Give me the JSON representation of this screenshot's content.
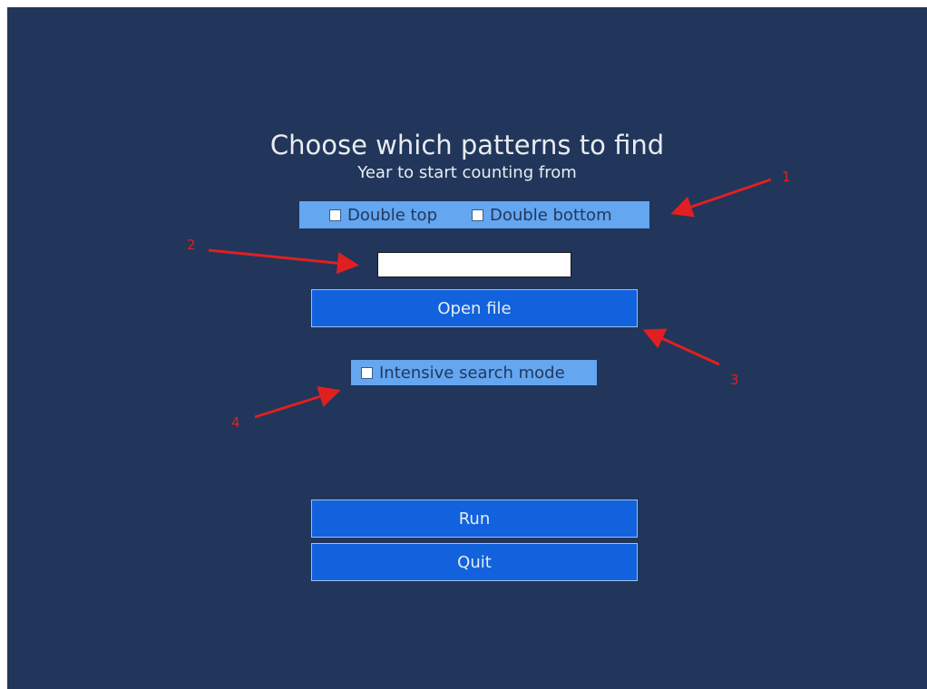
{
  "window": {
    "title": "Choose which patterns to find",
    "subtitle": "Year to start counting from"
  },
  "patterns": {
    "double_top_label": "Double top",
    "double_bottom_label": "Double bottom",
    "double_top_checked": false,
    "double_bottom_checked": false
  },
  "year_input": {
    "value": ""
  },
  "buttons": {
    "open_file_label": "Open file",
    "run_label": "Run",
    "quit_label": "Quit"
  },
  "intensive": {
    "label": "Intensive search mode",
    "checked": false
  },
  "annotations": {
    "marker_1": "1",
    "marker_2": "2",
    "marker_3": "3",
    "marker_4": "4"
  },
  "colors": {
    "background": "#21365a",
    "checkbar": "#64a6f0",
    "button": "#1162dc",
    "annotation": "#e02020"
  }
}
